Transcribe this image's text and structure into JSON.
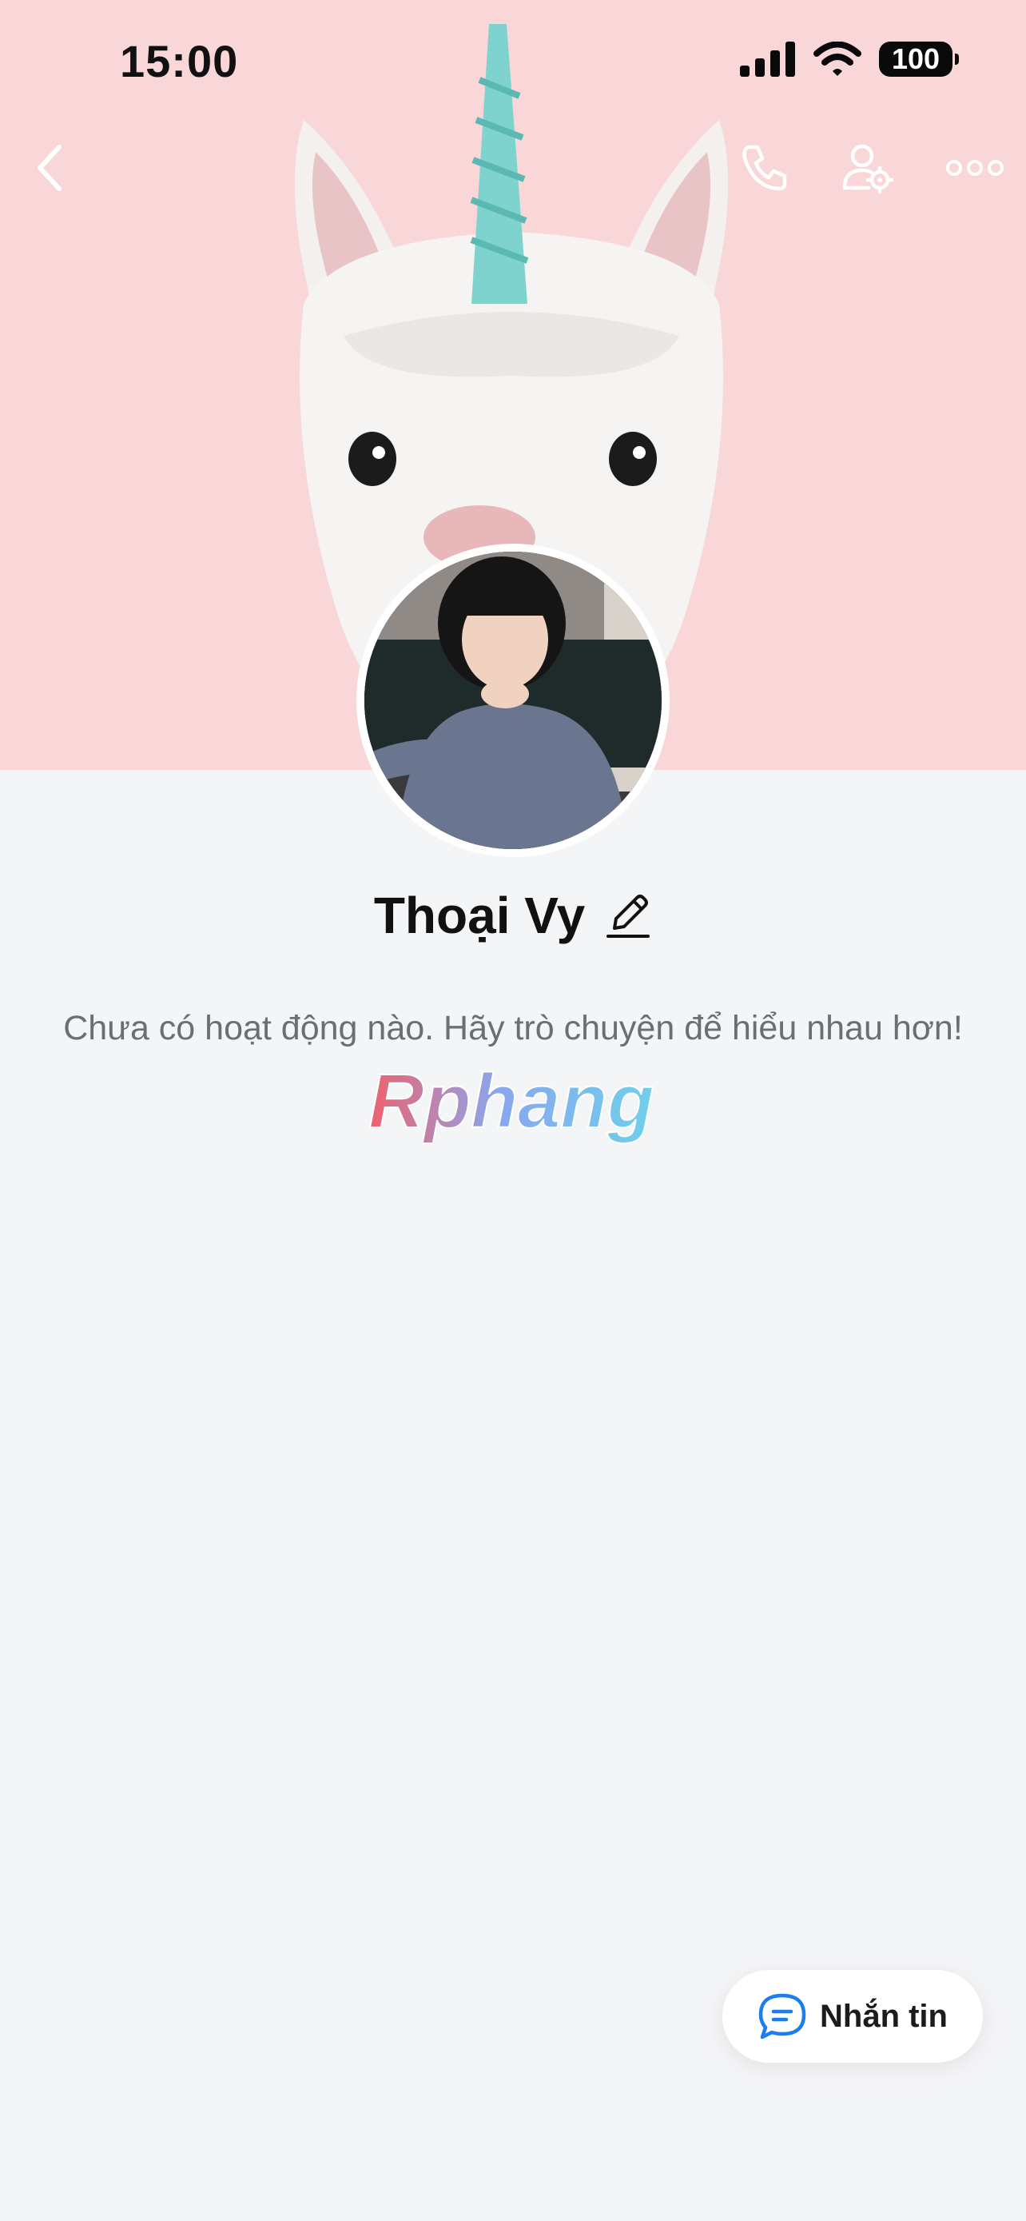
{
  "status_bar": {
    "time": "15:00",
    "battery": "100"
  },
  "nav": {
    "back_icon": "chevron-left-icon",
    "call_icon": "phone-icon",
    "settings_icon": "user-settings-icon",
    "more_icon": "more-dots-icon"
  },
  "profile": {
    "name": "Thoại Vy",
    "activity_text": "Chưa có hoạt động nào. Hãy trò chuyện để hiểu nhau hơn!"
  },
  "watermark": {
    "text": "Rphang"
  },
  "message_button": {
    "label": "Nhắn tin"
  },
  "colors": {
    "cover_background": "#f9d6d8",
    "page_background": "#f4f5f7",
    "accent_blue": "#1a7df0"
  }
}
